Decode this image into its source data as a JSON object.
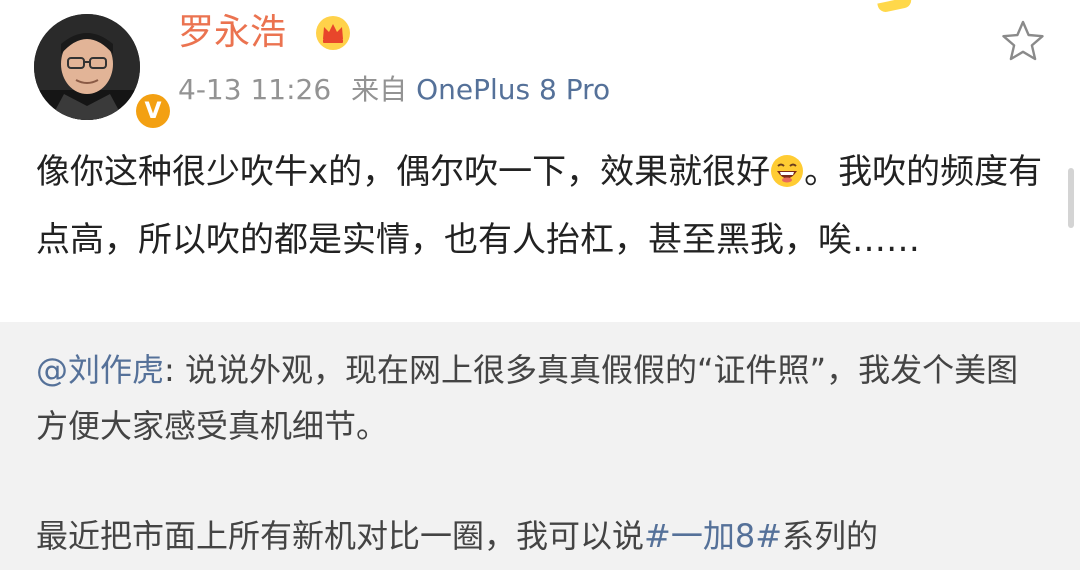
{
  "post": {
    "author": "罗永浩",
    "time": "4-13 11:26",
    "source_prefix": "来自",
    "source_device": "OnePlus 8 Pro",
    "text_part1": "像你这种很少吹牛x的，偶尔吹一下，效果就很好",
    "text_part2": "。我吹的频度有点高，所以吹的都是实情，也有人抬杠，甚至黑我，唉……",
    "emoji": "laughing-emoji"
  },
  "quote": {
    "mention": "@刘作虎",
    "text": ": 说说外观，现在网上很多真真假假的“证件照”，我发个美图方便大家感受真机细节。",
    "text2_part1": "最近把市面上所有新机对比一圈，我可以说",
    "hashtag": "#一加8#",
    "text2_part2": "系列的"
  },
  "colors": {
    "username": "#eb7350",
    "link": "#557199",
    "meta": "#939393",
    "quote_bg": "#f2f2f2",
    "verified": "#f3a012"
  },
  "icons": {
    "verified": "verified-v-icon",
    "crown": "crown-icon",
    "favorite": "star-outline-icon"
  }
}
